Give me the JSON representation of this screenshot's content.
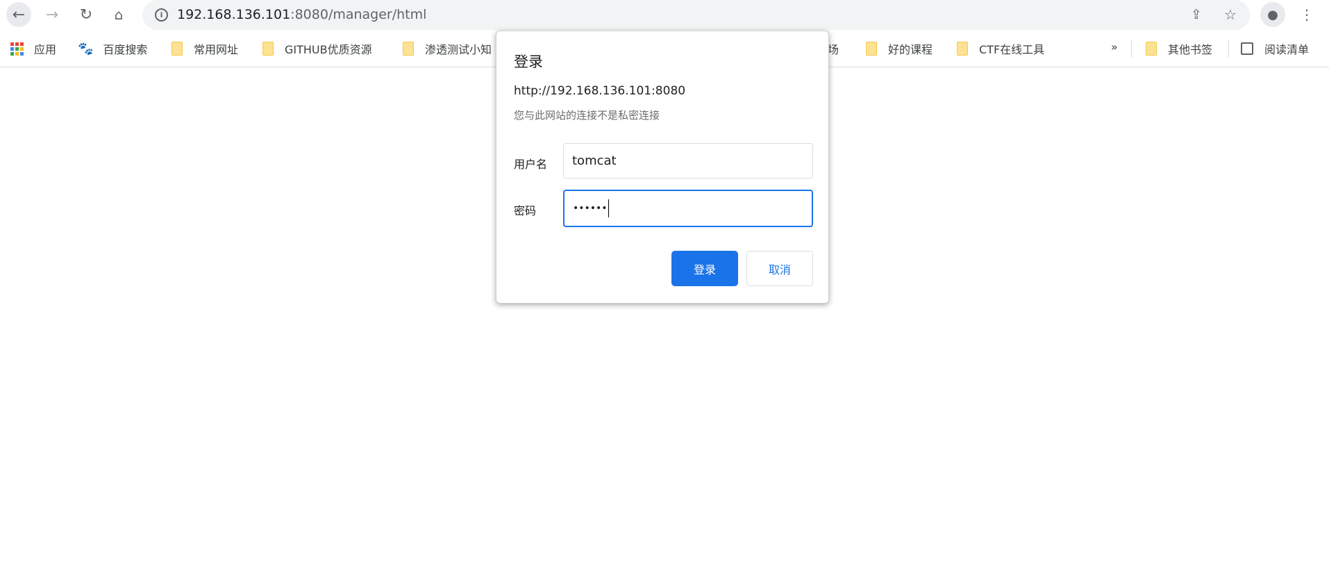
{
  "browser": {
    "url_host": "192.168.136.101",
    "url_rest": ":8080/manager/html",
    "icons": [
      "back-icon",
      "forward-icon",
      "reload-icon",
      "home-icon",
      "info-icon",
      "share-icon",
      "star-icon",
      "profile-icon",
      "menu-icon"
    ]
  },
  "bookmarks": {
    "items": [
      {
        "label": "应用",
        "icon": "apps-icon"
      },
      {
        "label": "百度搜索",
        "icon": "baidu-icon"
      },
      {
        "label": "常用网址",
        "icon": "folder-icon"
      },
      {
        "label": "GITHUB优质资源",
        "icon": "folder-icon"
      },
      {
        "label": "渗透测试小知",
        "icon": "folder-icon"
      },
      {
        "label": "场",
        "icon": ""
      },
      {
        "label": "好的课程",
        "icon": "folder-icon"
      },
      {
        "label": "CTF在线工具",
        "icon": "folder-icon"
      }
    ],
    "overflow": "»",
    "other": "其他书签",
    "reading_list": "阅读清单"
  },
  "dialog": {
    "title": "登录",
    "origin": "http://192.168.136.101:8080",
    "note": "您与此网站的连接不是私密连接",
    "username_label": "用户名",
    "username_value": "tomcat",
    "password_label": "密码",
    "password_value": "••••••",
    "ok_label": "登录",
    "cancel_label": "取消",
    "accent": "#1a73e8"
  }
}
